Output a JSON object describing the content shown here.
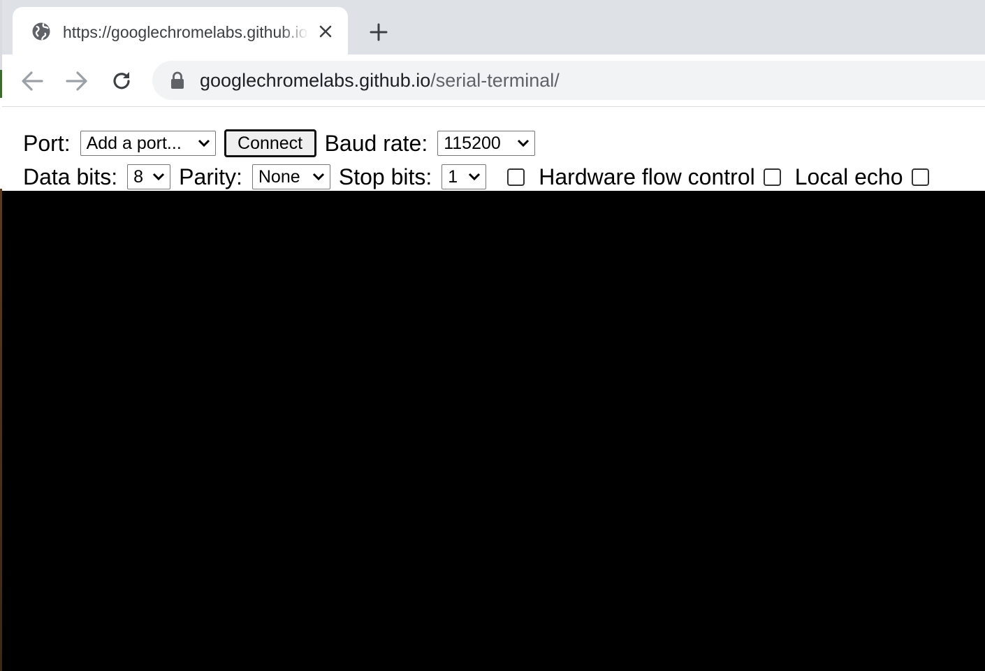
{
  "browser": {
    "tab": {
      "title": "https://googlechromelabs.github.io/serial-terminal/",
      "favicon": "globe-icon"
    },
    "new_tab_icon": "plus-icon",
    "nav": {
      "back_icon": "arrow-left-icon",
      "forward_icon": "arrow-right-icon",
      "reload_icon": "reload-icon"
    },
    "address": {
      "host": "googlechromelabs.github.io",
      "path": "/serial-terminal/",
      "lock_icon": "lock-icon"
    }
  },
  "controls": {
    "port": {
      "label": "Port:",
      "selected": "Add a port..."
    },
    "connect_label": "Connect",
    "baud": {
      "label": "Baud rate:",
      "selected": "115200"
    },
    "data_bits": {
      "label": "Data bits:",
      "selected": "8"
    },
    "parity": {
      "label": "Parity:",
      "selected": "None"
    },
    "stop_bits": {
      "label": "Stop bits:",
      "selected": "1"
    },
    "flow_control": {
      "label": "Hardware flow control",
      "checked": false
    },
    "local_echo": {
      "label": "Local echo",
      "checked": false
    }
  },
  "terminal": {
    "background": "#000000"
  },
  "colors": {
    "tab_strip": "#dee1e6",
    "omnibox": "#f1f3f4",
    "url_path": "#5f6368"
  }
}
